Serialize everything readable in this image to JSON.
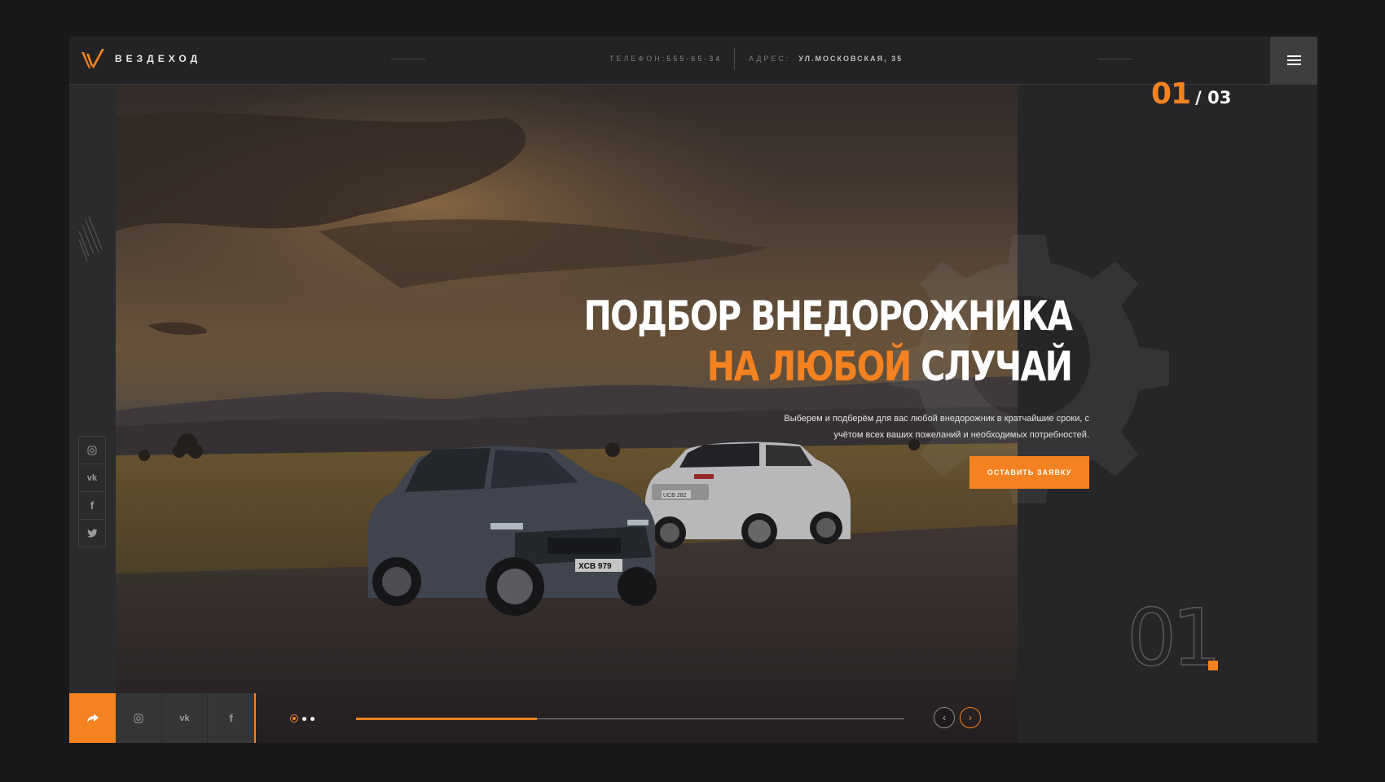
{
  "header": {
    "brand": "ВЕЗДЕХОД",
    "phone_label": "ТЕЛЕФОН:",
    "phone_value": "555-65-34",
    "address_label": "АДРЕС:",
    "address_value": "УЛ.МОСКОВСКАЯ, 35",
    "menu_icon": "hamburger-menu-icon"
  },
  "slide_counter": {
    "current": "01",
    "total": "/ 03"
  },
  "hero": {
    "headline_line1": "ПОДБОР ВНЕДОРОЖНИКА",
    "headline_accent": "НА ЛЮБОЙ",
    "headline_rest": " СЛУЧАЙ",
    "subtitle_line1": "Выберем и подберём для вас любой внедорожник в кратчайшие сроки, с",
    "subtitle_line2": "учётом всех ваших пожеланий и необходимых потребностей.",
    "cta_label": "ОСТАВИТЬ ЗАЯВКУ",
    "plate_front": "XCB 979",
    "plate_rear": "UCB 282"
  },
  "side_social": [
    "instagram-icon",
    "vk-icon",
    "facebook-icon",
    "twitter-icon"
  ],
  "bottom_bar": {
    "share_icon": "share-arrow-icon",
    "social": [
      "instagram-icon",
      "vk-icon",
      "facebook-icon"
    ],
    "vk_text": "vk",
    "fb_text": "f"
  },
  "slider": {
    "dots_count": 3,
    "active_dot": 1,
    "progress_fraction": 0.33,
    "prev_symbol": "‹",
    "next_symbol": "›"
  },
  "big_number": "01",
  "colors": {
    "accent": "#f58220",
    "background": "#19181b",
    "panel": "#262628"
  }
}
